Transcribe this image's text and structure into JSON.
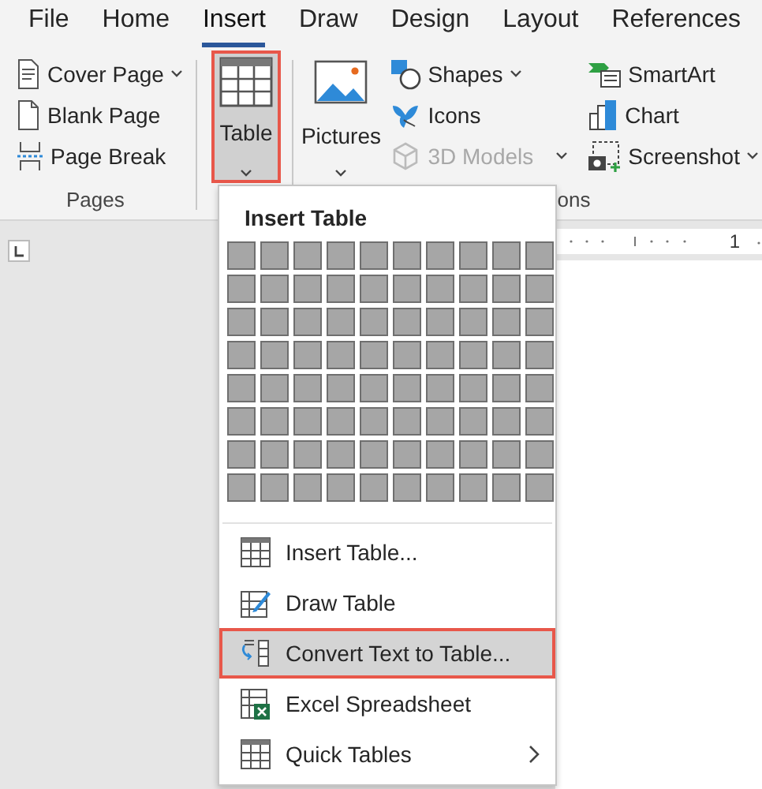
{
  "tabs": [
    {
      "label": "File",
      "selected": false
    },
    {
      "label": "Home",
      "selected": false
    },
    {
      "label": "Insert",
      "selected": true
    },
    {
      "label": "Draw",
      "selected": false
    },
    {
      "label": "Design",
      "selected": false
    },
    {
      "label": "Layout",
      "selected": false
    },
    {
      "label": "References",
      "selected": false
    }
  ],
  "pages_group": {
    "label": "Pages",
    "items": [
      {
        "label": "Cover Page",
        "dropdown": true
      },
      {
        "label": "Blank Page",
        "dropdown": false
      },
      {
        "label": "Page Break",
        "dropdown": false
      }
    ]
  },
  "table_button": {
    "label": "Table",
    "pressed": true
  },
  "illustrations_group": {
    "label": "ons",
    "pictures": {
      "label": "Pictures"
    },
    "column_1": [
      {
        "label": "Shapes",
        "dropdown": true,
        "disabled": false
      },
      {
        "label": "Icons",
        "dropdown": false,
        "disabled": false
      },
      {
        "label": "3D Models",
        "dropdown": true,
        "disabled": true
      }
    ],
    "column_2": [
      {
        "label": "SmartArt",
        "dropdown": false,
        "disabled": false
      },
      {
        "label": "Chart",
        "dropdown": false,
        "disabled": false
      },
      {
        "label": "Screenshot",
        "dropdown": true,
        "disabled": false
      }
    ]
  },
  "ruler": {
    "number": "1"
  },
  "menu": {
    "title": "Insert Table",
    "grid": [
      [
        false,
        false,
        false,
        false,
        false,
        false,
        false,
        false,
        false,
        false
      ],
      [
        false,
        false,
        false,
        false,
        false,
        false,
        false,
        false,
        false,
        false
      ],
      [
        false,
        false,
        false,
        false,
        false,
        false,
        false,
        false,
        false,
        false
      ],
      [
        false,
        false,
        false,
        false,
        false,
        false,
        false,
        false,
        false,
        false
      ],
      [
        false,
        false,
        false,
        false,
        false,
        false,
        false,
        false,
        false,
        false
      ],
      [
        false,
        false,
        false,
        false,
        false,
        false,
        false,
        false,
        false,
        false
      ],
      [
        false,
        false,
        false,
        false,
        false,
        false,
        false,
        false,
        false,
        false
      ],
      [
        false,
        false,
        false,
        false,
        false,
        false,
        false,
        false,
        false,
        false
      ]
    ],
    "items": [
      {
        "label": "Insert Table...",
        "highlighted": false,
        "submenu": false
      },
      {
        "label": "Draw Table",
        "highlighted": false,
        "submenu": false
      },
      {
        "label": "Convert Text to Table...",
        "highlighted": true,
        "submenu": false
      },
      {
        "label": "Excel Spreadsheet",
        "highlighted": false,
        "submenu": false
      },
      {
        "label": "Quick Tables",
        "highlighted": false,
        "submenu": true
      }
    ]
  }
}
